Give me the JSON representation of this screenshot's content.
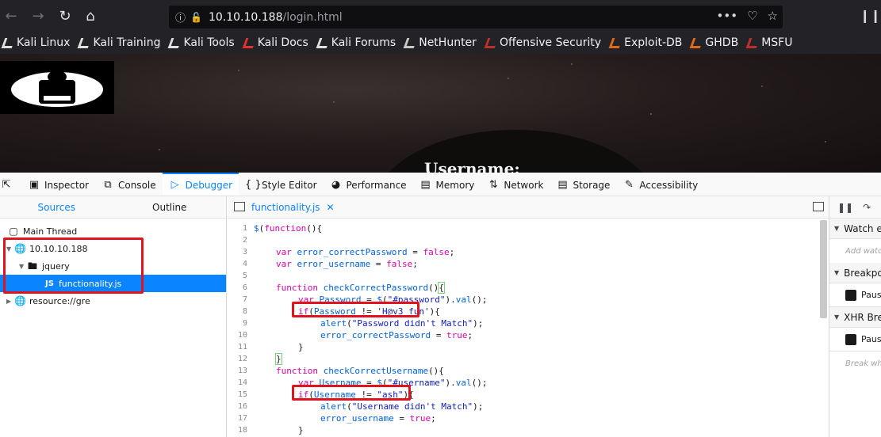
{
  "browser": {
    "url_host": "10.10.10.188",
    "url_path": "/login.html",
    "bookmarks": [
      {
        "label": "Kali Linux",
        "icon": "kali-dragon-icon"
      },
      {
        "label": "Kali Training",
        "icon": "kali-dragon-icon"
      },
      {
        "label": "Kali Tools",
        "icon": "kali-dragon-icon"
      },
      {
        "label": "Kali Docs",
        "icon": "kali-docs-icon"
      },
      {
        "label": "Kali Forums",
        "icon": "kali-dragon-icon"
      },
      {
        "label": "NetHunter",
        "icon": "nethunter-icon"
      },
      {
        "label": "Offensive Security",
        "icon": "offsec-icon"
      },
      {
        "label": "Exploit-DB",
        "icon": "exploitdb-icon"
      },
      {
        "label": "GHDB",
        "icon": "ghdb-icon"
      },
      {
        "label": "MSFU",
        "icon": "msfu-icon"
      }
    ]
  },
  "page": {
    "label": "Username:"
  },
  "devtools": {
    "tabs": [
      {
        "label": "Inspector",
        "icon": "inspector-icon"
      },
      {
        "label": "Console",
        "icon": "console-icon"
      },
      {
        "label": "Debugger",
        "icon": "debugger-icon"
      },
      {
        "label": "Style Editor",
        "icon": "style-editor-icon"
      },
      {
        "label": "Performance",
        "icon": "performance-icon"
      },
      {
        "label": "Memory",
        "icon": "memory-icon"
      },
      {
        "label": "Network",
        "icon": "network-icon"
      },
      {
        "label": "Storage",
        "icon": "storage-icon"
      },
      {
        "label": "Accessibility",
        "icon": "accessibility-icon"
      }
    ],
    "active_tab": "Debugger",
    "sources": {
      "tab_sources": "Sources",
      "tab_outline": "Outline",
      "tree": {
        "thread": "Main Thread",
        "host": "10.10.10.188",
        "folder": "jquery",
        "file": "functionality.js",
        "file_badge": "JS",
        "other": "resource://gre"
      }
    },
    "editor": {
      "open_file": "functionality.js",
      "line_numbers": [
        "1",
        "2",
        "3",
        "4",
        "5",
        "6",
        "7",
        "8",
        "9",
        "10",
        "11",
        "12",
        "13",
        "14",
        "15",
        "16",
        "17",
        "18"
      ]
    },
    "right_panel": {
      "watch": "Watch expressions",
      "watch_hint": "Add watch expression",
      "breakpoints": "Breakpoints",
      "pause_exceptions": "Pause on exceptions",
      "xhr": "XHR Breakpoints",
      "pause_xhr": "Pause on any URL",
      "break_hint": "Break when URL contains"
    },
    "accent_color": "#0a84ff",
    "highlight_color": "#e0141e"
  }
}
